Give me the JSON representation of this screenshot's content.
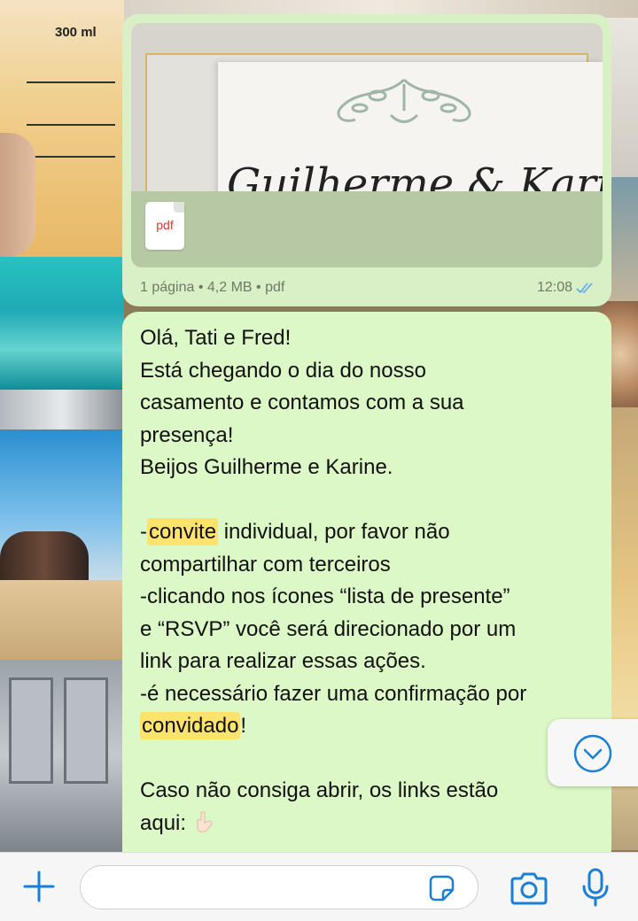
{
  "wallpaper": {
    "cup_label": "300 ml"
  },
  "document_message": {
    "card_names": "Guilherme & Karine",
    "file_type_icon": "pdf",
    "meta": "1 página • 4,2 MB • pdf",
    "time": "12:08",
    "status_icon": "double-check-icon",
    "status_color": "#5fa8e8"
  },
  "text_message": {
    "lines": [
      "Olá, Tati e Fred!",
      "Está chegando o dia do nosso",
      "casamento e contamos com a sua",
      "presença!",
      "Beijos Guilherme e Karine.",
      "",
      "individual, por favor não",
      "compartilhar com terceiros",
      "-clicando nos ícones “lista de presente”",
      "e “RSVP” você será direcionado por um",
      "link para realizar essas ações.",
      "-é necessário fazer uma confirmação por",
      "",
      "",
      "Caso não consiga abrir, os links estão",
      "aqui:"
    ],
    "line7_prefix": "-",
    "highlight_1": "convite",
    "highlight_2": "convidado",
    "line13_suffix": "!",
    "emoji_icon": "pointing-down-hand-icon"
  },
  "scroll_button": {
    "icon": "chevron-down-circle-icon"
  },
  "input_bar": {
    "attach_icon": "plus-icon",
    "text_value": "",
    "sticker_icon": "sticker-icon",
    "camera_icon": "camera-icon",
    "mic_icon": "microphone-icon",
    "accent_color": "#1a7fd6"
  }
}
